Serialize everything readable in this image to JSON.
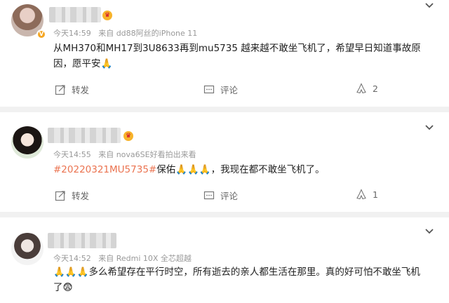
{
  "posts": [
    {
      "time": "今天14:59",
      "source": "来自 dd88阿丝的iPhone 11",
      "text": "从MH370和MH17到3U8633再到mu5735 越来越不敢坐飞机了，希望早日知道事故原因，愿平安",
      "emoji_tail": "🙏",
      "forward_label": "转发",
      "comment_label": "评论",
      "like_count": "2",
      "verified": "V"
    },
    {
      "time": "今天14:55",
      "source": "来自 nova6SE好看拍出来看",
      "hashtag": "#20220321MU5735#",
      "text_pre": "保佑",
      "emojis": "🙏🙏🙏",
      "text_post": "，我现在都不敢坐飞机了。",
      "forward_label": "转发",
      "comment_label": "评论",
      "like_count": "1"
    },
    {
      "time": "今天14:52",
      "source": "来自 Redmi 10X 全芯超越",
      "emojis": "🙏🙏🙏",
      "text": "多么希望存在平行时空，所有逝去的亲人都生活在那里。真的好可怕不敢坐飞机了",
      "emoji_tail": "😨"
    }
  ],
  "icons": {
    "forward": "forward-icon",
    "comment": "comment-icon",
    "like": "like-icon",
    "more": "chevron-down-icon"
  },
  "colors": {
    "hashtag": "#eb7350",
    "meta": "#999999",
    "background": "#f1f1f1"
  }
}
